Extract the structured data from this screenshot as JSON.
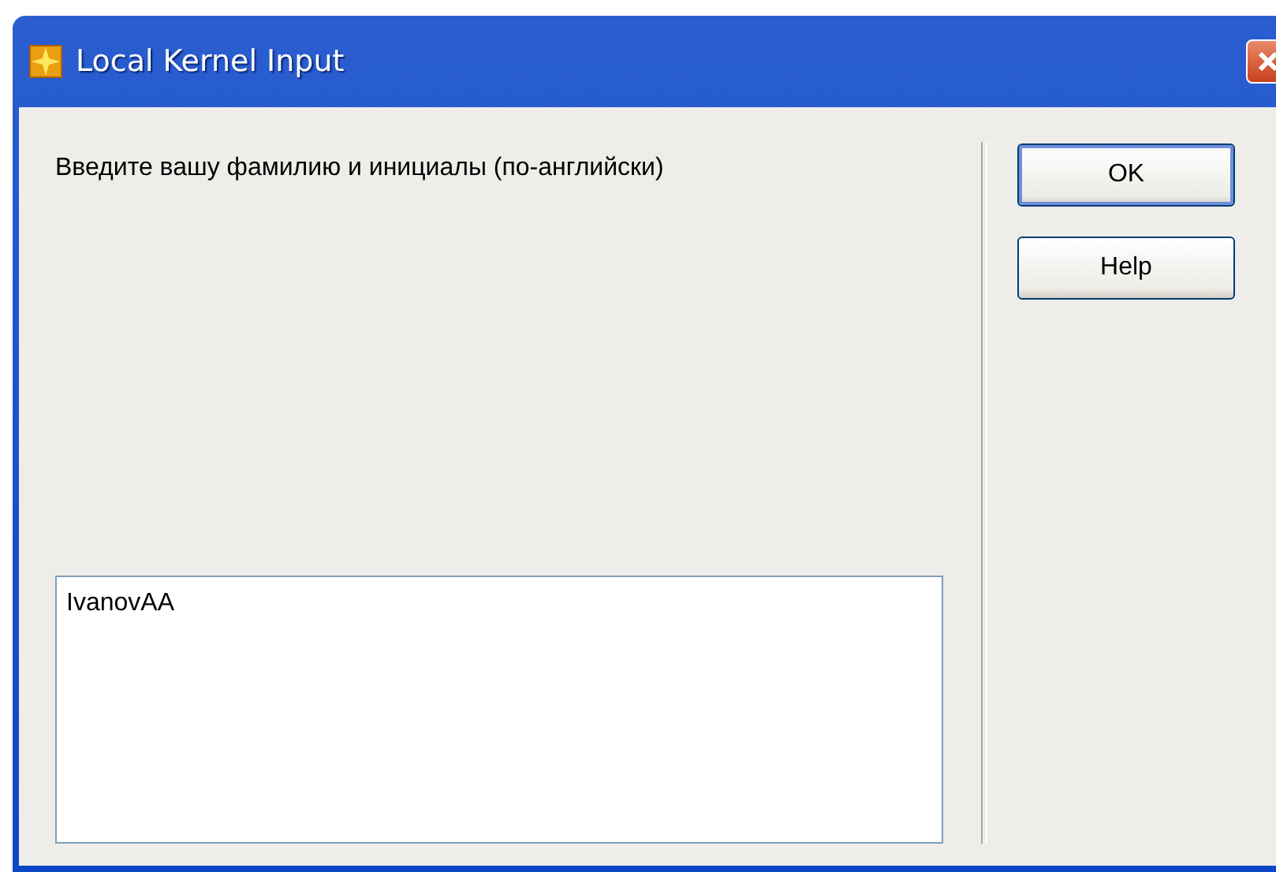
{
  "window": {
    "title": "Local Kernel Input"
  },
  "prompt": "Введите вашу фамилию и инициалы (по-английски)",
  "input": {
    "value": "IvanovAA"
  },
  "buttons": [
    {
      "label": "OK",
      "default": true
    },
    {
      "label": "Help",
      "default": false
    }
  ]
}
